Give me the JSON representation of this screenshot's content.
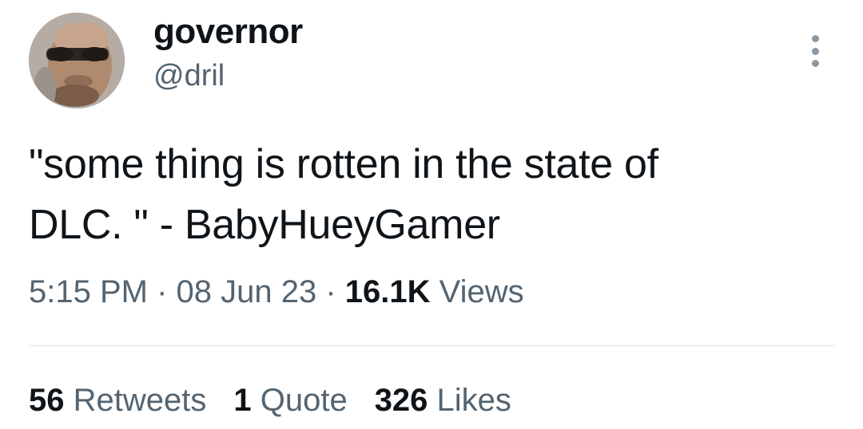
{
  "author": {
    "display_name": "governor",
    "handle": "@dril",
    "avatar_icon": "avatar-image"
  },
  "more_icon": "more-vertical-icon",
  "tweet": {
    "text": "\"some thing is rotten in the state of\nDLC. \" - BabyHueyGamer",
    "time": "5:15 PM",
    "separator_1": " · ",
    "date": "08 Jun 23",
    "separator_2": " · ",
    "views_count": "16.1K",
    "views_label": " Views"
  },
  "stats": {
    "retweets_count": "56",
    "retweets_label": " Retweets",
    "quotes_count": "1",
    "quotes_label": " Quote",
    "likes_count": "326",
    "likes_label": " Likes"
  },
  "colors": {
    "primary_text": "#0f1419",
    "secondary_text": "#536471",
    "divider": "#dfe3e6"
  }
}
